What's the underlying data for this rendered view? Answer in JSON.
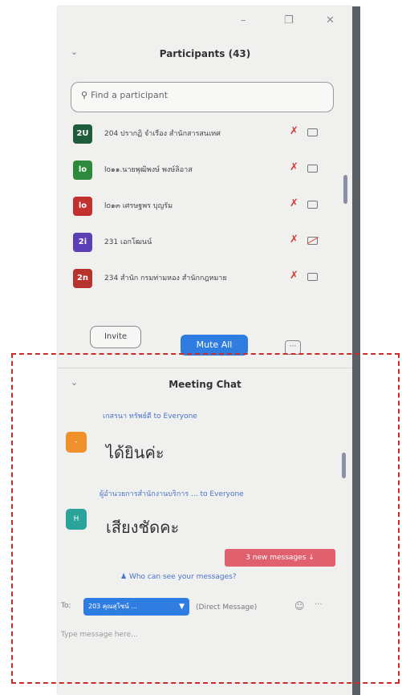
{
  "window": {
    "minimize_icon": "minimize-icon",
    "maximize_icon": "maximize-icon",
    "close_icon": "close-icon"
  },
  "participants": {
    "title": "Participants (43)",
    "search_placeholder": "Find a participant",
    "list": [
      {
        "initials": "2U",
        "color": "#1f5c3a",
        "name": "204 ปรากฏิ จำเรือง สำนักสารสนเทศ",
        "mic": "muted",
        "video": "off"
      },
      {
        "initials": "lo",
        "color": "#2d8a3c",
        "name": "lo๑๑.นายพุฒิพงษ์ พงษ์ลิอาส",
        "mic": "muted",
        "video": "off"
      },
      {
        "initials": "lo",
        "color": "#c2302f",
        "name": "lo๑๓ เศรษฐพร บุญรัม",
        "mic": "muted",
        "video": "off"
      },
      {
        "initials": "2i",
        "color": "#5b3fb7",
        "name": "231 เอกโฒนน์",
        "mic": "muted",
        "video": "off"
      },
      {
        "initials": "2n",
        "color": "#b8322e",
        "name": "234 สำนัก กรมท่ามหอง สำนักกฎหมาย",
        "mic": "muted",
        "video": "off"
      }
    ],
    "invite_label": "Invite",
    "mute_all_label": "Mute All",
    "more_label": "···"
  },
  "chat": {
    "title": "Meeting Chat",
    "messages": [
      {
        "sender": "เกสรนา ทรัพย์ดี",
        "to": "to Everyone",
        "text": "ได้ยินค่ะ",
        "avatar_color": "#f0902a",
        "avatar_initial": "-"
      },
      {
        "sender": "ผู้อำนวยการสำนักงานบริการ ...",
        "to": "to Everyone",
        "text": "เสียงชัดคะ",
        "avatar_color": "#2aa39a",
        "avatar_initial": "H"
      }
    ],
    "new_messages_label": "3 new messages ↓",
    "who_can_see": "Who can see your messages?",
    "to_label": "To:",
    "recipient": "203 คุณสุโซน์ ...",
    "direct_message": "(Direct Message)",
    "input_placeholder": "Type message here..."
  }
}
